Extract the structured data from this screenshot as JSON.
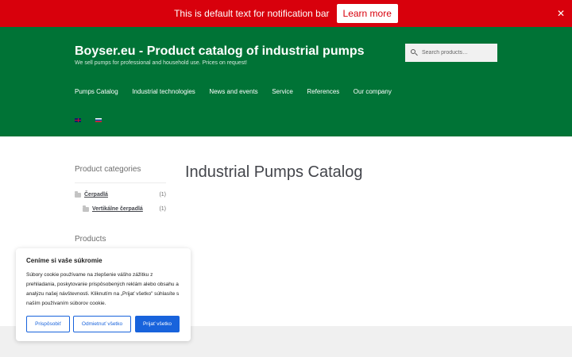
{
  "notification_bar": {
    "text": "This is default text for notification bar",
    "button_label": "Learn more",
    "close_symbol": "✕",
    "background": "#d8000c"
  },
  "header": {
    "site_title": "Boyser.eu - Product catalog of industrial pumps",
    "tagline": "We sell pumps for professional and household use. Prices on request!",
    "background": "#007336",
    "search": {
      "placeholder": "Search products…",
      "icon": "search-icon"
    },
    "nav": [
      {
        "label": "Pumps Catalog"
      },
      {
        "label": "Industrial technologies"
      },
      {
        "label": "News and events"
      },
      {
        "label": "Service"
      },
      {
        "label": "References"
      },
      {
        "label": "Our company"
      }
    ],
    "languages": [
      {
        "icon": "flag-gb-icon"
      },
      {
        "icon": "flag-sk-icon"
      }
    ]
  },
  "sidebar": {
    "categories_heading": "Product categories",
    "categories": [
      {
        "label": "Čerpadlá",
        "count": "(1)"
      },
      {
        "label": "Vertikálne čerpadlá",
        "count": "(1)"
      }
    ],
    "products_heading": "Products"
  },
  "main": {
    "page_title": "Industrial Pumps Catalog"
  },
  "cookie_banner": {
    "title": "Ceníme si vaše súkromie",
    "text": "Súbory cookie používame na zlepšenie vášho zážitku z prehliadania, poskytovanie prispôsobených reklám alebo obsahu a analýzu našej návštevnosti. Kliknutím na „Prijať všetko\" súhlasíte s naším používaním súborov cookie.",
    "customize_label": "Prispôsobiť",
    "reject_label": "Odmietnuť všetko",
    "accept_label": "Prijať všetko",
    "accent": "#1863dc"
  }
}
